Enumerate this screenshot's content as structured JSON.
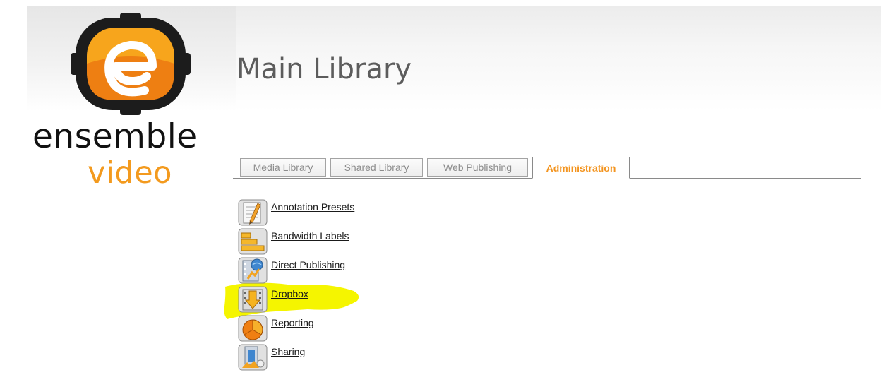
{
  "brand": {
    "word1": "ensemble",
    "word2": "video",
    "accent_color": "#f39a1e"
  },
  "page": {
    "title": "Main Library"
  },
  "tabs": [
    {
      "label": "Media Library",
      "active": false
    },
    {
      "label": "Shared Library",
      "active": false
    },
    {
      "label": "Web Publishing",
      "active": false
    },
    {
      "label": "Administration",
      "active": true
    }
  ],
  "admin_items": [
    {
      "label": "Annotation Presets",
      "icon": "annotation-presets-icon"
    },
    {
      "label": "Bandwidth Labels",
      "icon": "bandwidth-labels-icon"
    },
    {
      "label": "Direct Publishing",
      "icon": "direct-publishing-icon"
    },
    {
      "label": "Dropbox",
      "icon": "dropbox-icon"
    },
    {
      "label": "Reporting",
      "icon": "reporting-icon"
    },
    {
      "label": "Sharing",
      "icon": "sharing-icon"
    }
  ],
  "highlight": {
    "target": "Dropbox",
    "color": "#f5f500"
  }
}
